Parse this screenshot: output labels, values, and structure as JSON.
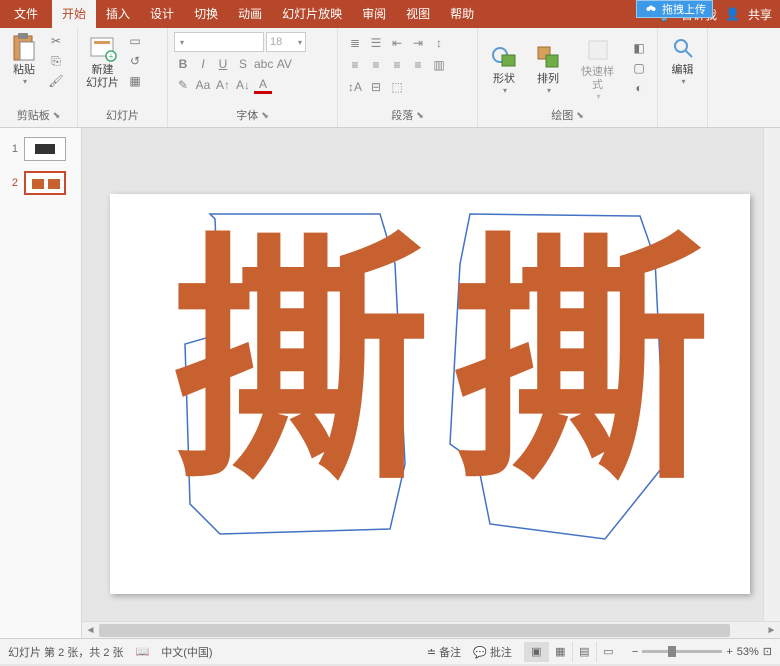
{
  "cloud_label": "拖拽上传",
  "tabs": {
    "file": "文件",
    "home": "开始",
    "insert": "插入",
    "design": "设计",
    "transition": "切换",
    "animation": "动画",
    "slideshow": "幻灯片放映",
    "review": "审阅",
    "view": "视图",
    "help": "帮助"
  },
  "tellme": "告诉我",
  "share": "共享",
  "ribbon": {
    "clipboard": {
      "label": "剪贴板",
      "paste": "粘贴"
    },
    "slides": {
      "label": "幻灯片",
      "new": "新建\n幻灯片"
    },
    "font": {
      "label": "字体",
      "size": "18"
    },
    "paragraph": {
      "label": "段落"
    },
    "drawing": {
      "label": "绘图",
      "shapes": "形状",
      "arrange": "排列",
      "quickstyle": "快速样式"
    },
    "editing": {
      "label": "编辑"
    }
  },
  "thumbs": [
    {
      "num": "1"
    },
    {
      "num": "2"
    }
  ],
  "slide_text": {
    "char1": "撕",
    "char2": "撕"
  },
  "status": {
    "slide_info": "幻灯片 第 2 张，共 2 张",
    "lang": "中文(中国)",
    "notes": "备注",
    "comments": "批注",
    "zoom": "53%"
  }
}
